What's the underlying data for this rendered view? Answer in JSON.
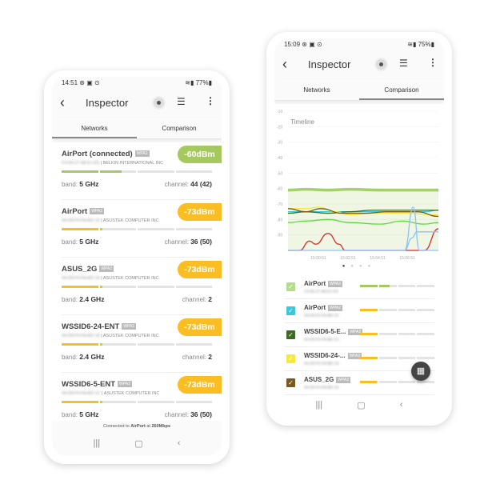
{
  "left_phone": {
    "status": {
      "time": "14:51",
      "icons": "⊛ ▣ ⊙",
      "right": "77%"
    },
    "app_title": "Inspector",
    "tabs": [
      {
        "label": "Networks",
        "active": true
      },
      {
        "label": "Comparison",
        "active": false
      }
    ],
    "networks": [
      {
        "name": "AirPort (connected)",
        "security": "WPA2",
        "mac": "C0:56:27:A8:E1:E5",
        "vendor": "| BELKIN INTERNATIONAL INC",
        "signal": "-60dBm",
        "signal_fraction": 0.4,
        "color": "#a5c95f",
        "band_label": "band:",
        "band": "5 GHz",
        "channel_label": "channel:",
        "channel": "44 (42)"
      },
      {
        "name": "AirPort",
        "security": "WPA2",
        "mac": "04:D9:F5:FA:BD:10",
        "vendor": "| ASUSTEK COMPUTER INC",
        "signal": "-73dBm",
        "signal_fraction": 0.27,
        "color": "#fbbd24",
        "band_label": "band:",
        "band": "5 GHz",
        "channel_label": "channel:",
        "channel": "36 (50)"
      },
      {
        "name": "ASUS_2G",
        "security": "WPA2",
        "mac": "04:D9:F5:FA:BD:19",
        "vendor": "| ASUSTEK COMPUTER INC",
        "signal": "-73dBm",
        "signal_fraction": 0.27,
        "color": "#fbbd24",
        "band_label": "band:",
        "band": "2.4 GHz",
        "channel_label": "channel:",
        "channel": "2"
      },
      {
        "name": "WSSID6-24-ENT",
        "security": "WPA2",
        "mac": "04:D9:F5:FA:BD:18",
        "vendor": "| ASUSTEK COMPUTER INC",
        "signal": "-73dBm",
        "signal_fraction": 0.27,
        "color": "#fbbd24",
        "band_label": "band:",
        "band": "2.4 GHz",
        "channel_label": "channel:",
        "channel": "2"
      },
      {
        "name": "WSSID6-5-ENT",
        "security": "WPA2",
        "mac": "04:D9:F5:FA:BD:1C",
        "vendor": "| ASUSTEK COMPUTER INC",
        "signal": "-73dBm",
        "signal_fraction": 0.27,
        "color": "#fbbd24",
        "band_label": "band:",
        "band": "5 GHz",
        "channel_label": "channel:",
        "channel": "36 (50)"
      }
    ],
    "footer": {
      "prefix": "Connected to ",
      "ssid": "AirPort",
      "mid": " at ",
      "speed": "260Mbps"
    }
  },
  "right_phone": {
    "status": {
      "time": "15:09",
      "icons": "⊛ ▣ ⊙",
      "right": "75%"
    },
    "app_title": "Inspector",
    "tabs": [
      {
        "label": "Networks",
        "active": false
      },
      {
        "label": "Comparison",
        "active": true
      }
    ],
    "pager_dots": 4,
    "networks": [
      {
        "name": "AirPort",
        "security": "WPA2",
        "mac": "C0:56:27:A8:E1:E5",
        "checkbox_color": "#b5dc8a",
        "checked": true,
        "signal_fraction": 0.4,
        "bar_color": "#a5c95f"
      },
      {
        "name": "AirPort",
        "security": "WPA2",
        "mac": "04:D9:F5:FA:BD:10",
        "checkbox_color": "#3ec6dc",
        "checked": true,
        "signal_fraction": 0.25,
        "bar_color": "#fbbd24"
      },
      {
        "name": "WSSID6-5-E...",
        "security": "WPA2",
        "mac": "04:D9:F5:FA:BD:1C",
        "checkbox_color": "#3d6b1f",
        "checked": true,
        "signal_fraction": 0.25,
        "bar_color": "#fbbd24"
      },
      {
        "name": "WSSID6-24-...",
        "security": "WPA2",
        "mac": "04:D9:F5:FA:BD:18",
        "checkbox_color": "#f7e83c",
        "checked": true,
        "signal_fraction": 0.25,
        "bar_color": "#fbbd24"
      },
      {
        "name": "ASUS_2G",
        "security": "WPA2",
        "mac": "04:D9:F5:FA:BD:19",
        "checkbox_color": "#7a5a1f",
        "checked": true,
        "signal_fraction": 0.24,
        "bar_color": "#fbbd24"
      }
    ]
  },
  "chart_data": {
    "type": "line",
    "title": "Timeline",
    "ylim": [
      -100,
      -10
    ],
    "yticks": [
      -10,
      -20,
      -30,
      -40,
      -50,
      -60,
      -70,
      -80,
      -90
    ],
    "xlim": [
      "14:58:48",
      "15:08:57"
    ],
    "xticks": [
      "15:00:51",
      "15:02:51",
      "15:04:51",
      "15:06:51"
    ],
    "grid": true,
    "series": [
      {
        "color": "#a5cf6a",
        "fill": true,
        "points": [
          [
            "14:58:48",
            -61
          ],
          [
            "15:00:00",
            -60.5
          ],
          [
            "15:01:30",
            -61
          ],
          [
            "15:03:00",
            -60.5
          ],
          [
            "15:05:00",
            -61
          ],
          [
            "15:07:00",
            -61
          ],
          [
            "15:08:57",
            -61
          ]
        ]
      },
      {
        "color": "#3ec6dc",
        "points": [
          [
            "14:58:48",
            -75
          ],
          [
            "15:00:00",
            -75
          ],
          [
            "15:02:00",
            -75
          ],
          [
            "15:04:00",
            -75
          ],
          [
            "15:06:00",
            -75
          ],
          [
            "15:08:00",
            -75
          ],
          [
            "15:08:57",
            -74
          ]
        ]
      },
      {
        "color": "#3d6b1f",
        "points": [
          [
            "14:58:48",
            -76
          ],
          [
            "15:00:00",
            -75
          ],
          [
            "15:01:30",
            -76
          ],
          [
            "15:03:00",
            -75
          ],
          [
            "15:04:30",
            -74
          ],
          [
            "15:06:00",
            -74
          ],
          [
            "15:08:57",
            -74
          ]
        ]
      },
      {
        "color": "#f7e83c",
        "points": [
          [
            "14:58:48",
            -73
          ],
          [
            "15:00:00",
            -73
          ],
          [
            "15:00:51",
            -72
          ],
          [
            "15:02:00",
            -75
          ],
          [
            "15:03:00",
            -77
          ],
          [
            "15:04:30",
            -76
          ],
          [
            "15:06:30",
            -76
          ],
          [
            "15:08:57",
            -77
          ]
        ]
      },
      {
        "color": "#7a5a1f",
        "points": [
          [
            "14:58:48",
            -73
          ],
          [
            "15:00:00",
            -75
          ],
          [
            "15:01:00",
            -73
          ],
          [
            "15:02:30",
            -76
          ],
          [
            "15:04:00",
            -76
          ],
          [
            "15:05:30",
            -75
          ],
          [
            "15:07:30",
            -75
          ],
          [
            "15:08:57",
            -78
          ]
        ]
      },
      {
        "color": "#5edb3c",
        "points": [
          [
            "14:58:48",
            -82
          ],
          [
            "15:00:00",
            -81
          ],
          [
            "15:01:30",
            -80
          ],
          [
            "15:03:00",
            -82
          ],
          [
            "15:05:00",
            -83
          ],
          [
            "15:06:30",
            -81
          ],
          [
            "15:08:00",
            -83
          ],
          [
            "15:08:57",
            -82
          ]
        ]
      },
      {
        "color": "#d62a2a",
        "points": [
          [
            "14:58:48",
            -100
          ],
          [
            "14:59:35",
            -100
          ],
          [
            "15:00:15",
            -94
          ],
          [
            "15:00:40",
            -96
          ],
          [
            "15:01:30",
            -89
          ],
          [
            "15:02:15",
            -96
          ],
          [
            "15:02:40",
            -100
          ],
          [
            "15:08:00",
            -100
          ],
          [
            "15:08:57",
            -86
          ]
        ]
      },
      {
        "color": "#8ec3f5",
        "points": [
          [
            "14:58:48",
            -100
          ],
          [
            "15:06:40",
            -100
          ],
          [
            "15:07:15",
            -72
          ],
          [
            "15:07:40",
            -100
          ],
          [
            "15:08:57",
            -100
          ]
        ]
      },
      {
        "color": "#8ec3f5",
        "points": [
          [
            "15:06:40",
            -100
          ],
          [
            "15:07:10",
            -92
          ],
          [
            "15:07:30",
            -88
          ],
          [
            "15:08:57",
            -88
          ]
        ]
      }
    ]
  },
  "colors": {
    "good": "#a5c95f",
    "fair": "#fbbd24",
    "track": "#e3e3e3"
  }
}
